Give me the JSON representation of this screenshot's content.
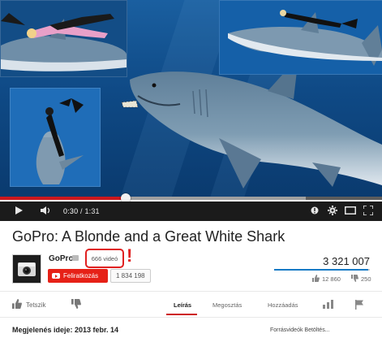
{
  "player": {
    "time_current": "0:30",
    "time_separator": " / ",
    "time_total": "1:31",
    "played_fraction": 0.33,
    "buffered_fraction": 0.8
  },
  "video": {
    "title": "GoPro: A Blonde and a Great White Shark",
    "views": "3 321 007",
    "likes": "12 860",
    "dislikes": "250",
    "like_fraction": 0.98
  },
  "channel": {
    "name": "GoPro",
    "video_count": "666 videó",
    "annotation_mark": "!",
    "subscribe_label": "Feliratkozás",
    "subscriber_count": "1 834 198"
  },
  "actions": {
    "like_label": "Tetszik"
  },
  "tabs": [
    {
      "label": "Leírás",
      "active": true
    },
    {
      "label": "Megosztás",
      "active": false
    },
    {
      "label": "Hozzáadás",
      "active": false
    }
  ],
  "description": {
    "published": "Megjelenés ideje: 2013 febr. 14",
    "source": "Forrásvideók Betöltés..."
  },
  "colors": {
    "accent_red": "#cc181e",
    "annotation_red": "#e02020",
    "like_blue": "#167ac6"
  },
  "icons": {
    "play": "play-icon",
    "volume": "volume-icon",
    "annotations": "annotations-icon",
    "settings": "gear-icon",
    "theater": "theater-mode-icon",
    "fullscreen": "fullscreen-icon",
    "thumbs_up": "thumbs-up-icon",
    "thumbs_down": "thumbs-down-icon",
    "stats": "stats-icon",
    "flag": "flag-icon"
  }
}
